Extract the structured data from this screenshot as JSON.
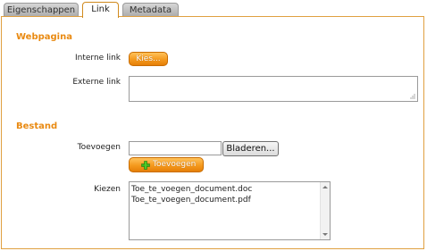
{
  "tabs": [
    {
      "label": "Eigenschappen"
    },
    {
      "label": "Link"
    },
    {
      "label": "Metadata"
    }
  ],
  "webpagina": {
    "heading": "Webpagina",
    "interne_link_label": "Interne link",
    "kies_button": "Kies...",
    "externe_link_label": "Externe link",
    "externe_link_value": ""
  },
  "bestand": {
    "heading": "Bestand",
    "toevoegen_label": "Toevoegen",
    "file_value": "",
    "bladeren_button": "Bladeren...",
    "toevoegen_button": "Toevoegen",
    "kiezen_label": "Kiezen",
    "files": [
      "Toe_te_voegen_document.doc",
      "Toe_te_voegen_document.pdf"
    ]
  },
  "colors": {
    "accent": "#e98a12",
    "button": "#f59a1e"
  },
  "icons": {
    "add": "plus-icon",
    "resize": "resize-grip-icon"
  }
}
